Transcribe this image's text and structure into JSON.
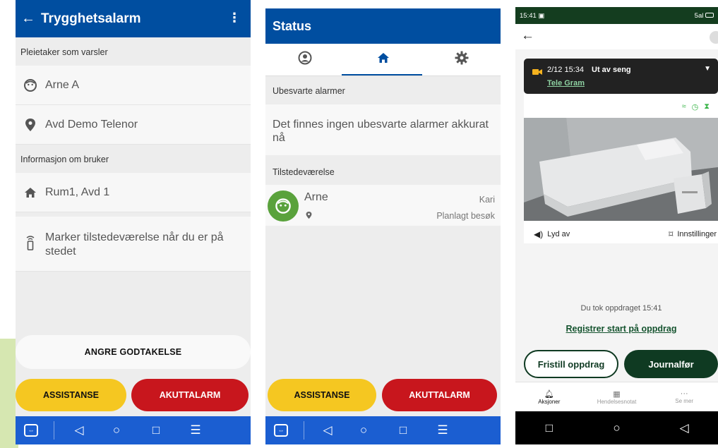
{
  "panel1": {
    "title": "Trygghetsalarm",
    "back_icon": "arrow-left-icon",
    "more_icon": "more-vert-icon",
    "section_patient": "Pleietaker som varsler",
    "patient_name": "Arne A",
    "location": "Avd Demo Telenor",
    "section_user_info": "Informasjon om bruker",
    "room": "Rum1, Avd 1",
    "presence_hint": "Marker tilstedeværelse når du er på stedet",
    "undo_accept": "ANGRE GODTAKELSE",
    "assist_label": "ASSISTANSE",
    "emergency_label": "AKUTTALARM",
    "colors": {
      "header": "#004ea0",
      "assist": "#f5c721",
      "emergency": "#c8161d",
      "navbar": "#1b5ed1"
    }
  },
  "panel2": {
    "title": "Status",
    "tabs": [
      {
        "icon": "account-icon",
        "active": false
      },
      {
        "icon": "home-icon",
        "active": true
      },
      {
        "icon": "settings-icon",
        "active": false
      }
    ],
    "section_unanswered": "Ubesvarte alarmer",
    "unanswered_msg": "Det finnes ingen ubesvarte alarmer akkurat nå",
    "section_presence": "Tilstedeværelse",
    "presence_name": "Arne",
    "presence_staff": "Kari",
    "presence_status": "Planlagt besøk",
    "assist_label": "ASSISTANSE",
    "emergency_label": "AKUTTALARM"
  },
  "panel3": {
    "status_time": "15:41",
    "status_signal": "5al",
    "alert_time": "2/12 15:34",
    "alert_type": "Ut av seng",
    "alert_source": "Tele Gram",
    "sound_label": "Lyd av",
    "settings_label": "Innstillinger",
    "assignment_time_text": "Du tok oppdraget 15:41",
    "register_start": "Registrer start på oppdrag",
    "release_label": "Fristill oppdrag",
    "journal_label": "Journalfør",
    "bottom_tabs": [
      "Aksjoner",
      "Hendelsesnotat",
      "Se mer"
    ],
    "colors": {
      "status_bar": "#143d1f",
      "primary": "#0f3a22",
      "link": "#14532e"
    }
  }
}
